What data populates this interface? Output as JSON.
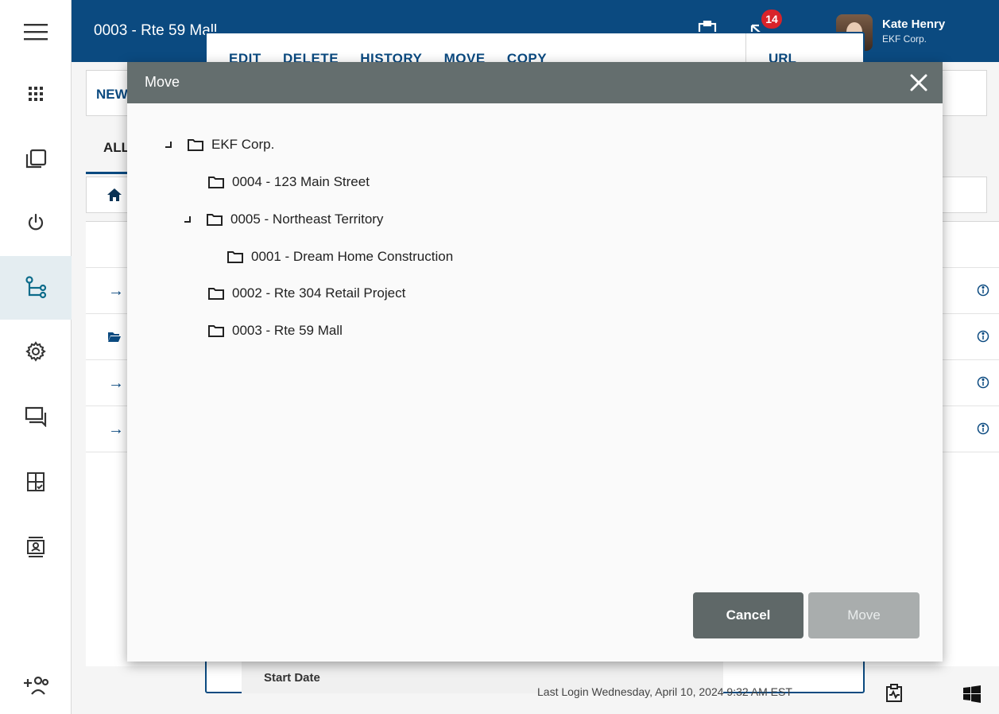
{
  "app": {
    "page_title": "0003 - Rte 59 Mall"
  },
  "header": {
    "notification_count": "14",
    "user": {
      "name": "Kate Henry",
      "org": "EKF Corp."
    }
  },
  "sidebar": {
    "items": [
      {
        "icon": "menu-icon"
      },
      {
        "icon": "apps-grid-icon"
      },
      {
        "icon": "folders-icon"
      },
      {
        "icon": "power-icon"
      },
      {
        "icon": "hierarchy-icon",
        "active": true
      },
      {
        "icon": "gear-icon"
      },
      {
        "icon": "chat-icon"
      },
      {
        "icon": "checklist-icon"
      },
      {
        "icon": "contact-card-icon"
      },
      {
        "icon": "add-users-icon"
      }
    ]
  },
  "background": {
    "toolbar_new_label": "NEW",
    "tab_all_label": "ALL",
    "row_icons": [
      "arrow-right-icon",
      "folder-open-icon",
      "arrow-right-icon",
      "arrow-right-icon"
    ],
    "detail_actions": [
      "EDIT",
      "DELETE",
      "HISTORY",
      "MOVE",
      "COPY"
    ],
    "detail_url_label": "URL",
    "detail_start_date_label": "Start Date",
    "last_login": "Last Login Wednesday, April 10, 2024 9:32 AM EST"
  },
  "modal": {
    "title": "Move",
    "tree": [
      {
        "label": "EKF Corp.",
        "level": 0,
        "expanded": true
      },
      {
        "label": "0004 - 123 Main Street",
        "level": 1,
        "expanded": false
      },
      {
        "label": "0005 - Northeast Territory",
        "level": 1,
        "expanded": true
      },
      {
        "label": "0001 - Dream Home Construction",
        "level": 2,
        "expanded": false
      },
      {
        "label": "0002 - Rte 304 Retail Project",
        "level": 1,
        "expanded": false
      },
      {
        "label": "0003 - Rte 59 Mall",
        "level": 1,
        "expanded": false
      }
    ],
    "cancel_label": "Cancel",
    "move_label": "Move",
    "move_enabled": false
  },
  "colors": {
    "brand_blue": "#0b4a80",
    "modal_header": "#646e6e",
    "badge_red": "#d8232a"
  }
}
